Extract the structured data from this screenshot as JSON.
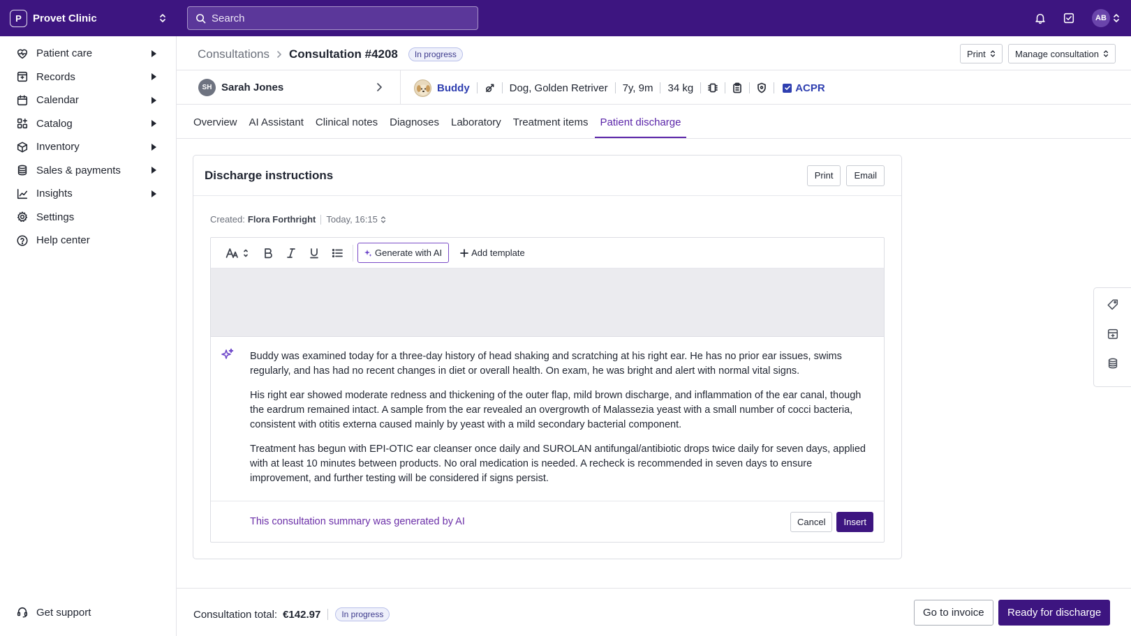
{
  "topbar": {
    "clinic_initial": "P",
    "clinic_name": "Provet Clinic",
    "search_placeholder": "Search",
    "user_initials": "AB"
  },
  "sidebar": {
    "items": [
      {
        "label": "Patient care",
        "icon": "heart-pulse-icon"
      },
      {
        "label": "Records",
        "icon": "folder-icon"
      },
      {
        "label": "Calendar",
        "icon": "calendar-icon"
      },
      {
        "label": "Catalog",
        "icon": "grid-plus-icon"
      },
      {
        "label": "Inventory",
        "icon": "box-icon"
      },
      {
        "label": "Sales & payments",
        "icon": "coins-icon"
      },
      {
        "label": "Insights",
        "icon": "line-chart-icon"
      },
      {
        "label": "Settings",
        "icon": "gear-icon"
      },
      {
        "label": "Help center",
        "icon": "help-icon"
      }
    ],
    "support_label": "Get support"
  },
  "header": {
    "breadcrumb_parent": "Consultations",
    "title": "Consultation #4208",
    "status": "In progress",
    "print_label": "Print",
    "manage_label": "Manage consultation"
  },
  "patient": {
    "owner_initials": "SH",
    "owner_name": "Sarah Jones",
    "pet_name": "Buddy",
    "species": "Dog, Golden Retriver",
    "age": "7y, 9m",
    "weight": "34 kg",
    "acpr_label": "ACPR"
  },
  "tabs": [
    "Overview",
    "AI Assistant",
    "Clinical notes",
    "Diagnoses",
    "Laboratory",
    "Treatment items",
    "Patient discharge"
  ],
  "active_tab": "Patient discharge",
  "discharge": {
    "title": "Discharge instructions",
    "print_label": "Print",
    "email_label": "Email",
    "created_label": "Created:",
    "created_by": "Flora Forthright",
    "created_when": "Today, 16:15",
    "generate_label": "Generate with AI",
    "add_template_label": "Add template",
    "paragraphs": [
      "Buddy was examined today for a three-day history of head shaking and scratching at his right ear. He has no prior ear issues, swims regularly, and has had no recent changes in diet or overall health. On exam, he was bright and alert with normal vital signs.",
      "His right ear showed moderate redness and thickening of the outer flap, mild brown discharge, and inflammation of the ear canal, though the eardrum remained intact. A sample from the ear revealed an overgrowth of Malassezia yeast with a small number of cocci bacteria, consistent with otitis externa caused mainly by yeast with a mild secondary bacterial component.",
      "Treatment has begun with EPI-OTIC ear cleanser once daily and SUROLAN antifungal/antibiotic drops twice daily for seven days, applied with at least 10 minutes between products. No oral medication is needed. A recheck is recommended in seven days to ensure improvement, and further testing will be considered if signs persist."
    ],
    "ai_note": "This consultation summary was generated by AI",
    "cancel_label": "Cancel",
    "insert_label": "Insert"
  },
  "footer": {
    "total_label": "Consultation total:",
    "total_value": "€142.97",
    "status": "In progress",
    "invoice_label": "Go to invoice",
    "ready_label": "Ready for discharge"
  },
  "colors": {
    "brand": "#3d1580",
    "accent": "#5a24a8",
    "link": "#2f3fb0"
  }
}
